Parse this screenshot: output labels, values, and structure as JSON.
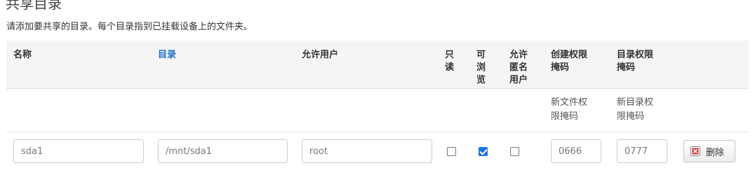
{
  "section": {
    "title": "共享目录",
    "description": "请添加要共享的目录。每个目录指到已挂载设备上的文件夹。"
  },
  "table": {
    "headers": {
      "name": "名称",
      "directory": "目录",
      "allowed_users": "允许用户",
      "read_only": "只读",
      "browsable": "可浏览",
      "guest_users": "允许匿名用户",
      "create_mask": "创建权限掩码",
      "dir_mask": "目录权限掩码"
    },
    "descriptions": {
      "create_mask": "新文件权限掩码",
      "dir_mask": "新目录权限掩码"
    },
    "rows": [
      {
        "name": "sda1",
        "directory": "/mnt/sda1",
        "users": "root",
        "read_only": false,
        "browsable": true,
        "guest": false,
        "create_mask": "0666",
        "dir_mask": "0777",
        "delete_label": "删除"
      }
    ]
  },
  "colors": {
    "link": "#1a6fc9",
    "header_bg": "#f5f5f5",
    "checkbox_checked": "#1a73e8",
    "delete_icon": "#d9302c"
  }
}
